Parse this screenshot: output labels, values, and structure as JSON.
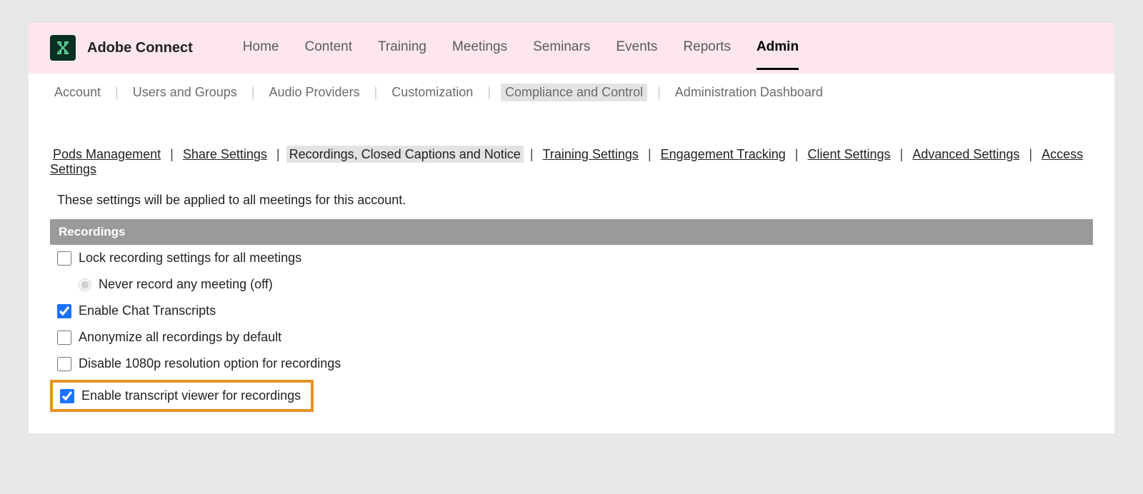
{
  "app": {
    "title": "Adobe Connect"
  },
  "mainNav": {
    "items": [
      "Home",
      "Content",
      "Training",
      "Meetings",
      "Seminars",
      "Events",
      "Reports",
      "Admin"
    ],
    "activeIndex": 7
  },
  "subNav": {
    "items": [
      "Account",
      "Users and Groups",
      "Audio Providers",
      "Customization",
      "Compliance and Control",
      "Administration Dashboard"
    ],
    "activeIndex": 4
  },
  "tertNav": {
    "items": [
      "Pods Management",
      "Share Settings",
      "Recordings, Closed Captions and Notice",
      "Training Settings",
      "Engagement Tracking",
      "Client Settings",
      "Advanced Settings",
      "Access Settings"
    ],
    "activeIndex": 2
  },
  "intro": "These settings will be applied to all meetings for this account.",
  "section": {
    "title": "Recordings",
    "lockRecording": {
      "label": "Lock recording settings for all meetings",
      "checked": false
    },
    "neverRecord": {
      "label": "Never record any meeting (off)",
      "selected": true
    },
    "enableChatTranscripts": {
      "label": "Enable Chat Transcripts",
      "checked": true
    },
    "anonymize": {
      "label": "Anonymize all recordings by default",
      "checked": false
    },
    "disable1080p": {
      "label": "Disable 1080p resolution option for recordings",
      "checked": false
    },
    "enableTranscriptViewer": {
      "label": "Enable transcript viewer for recordings",
      "checked": true
    }
  }
}
